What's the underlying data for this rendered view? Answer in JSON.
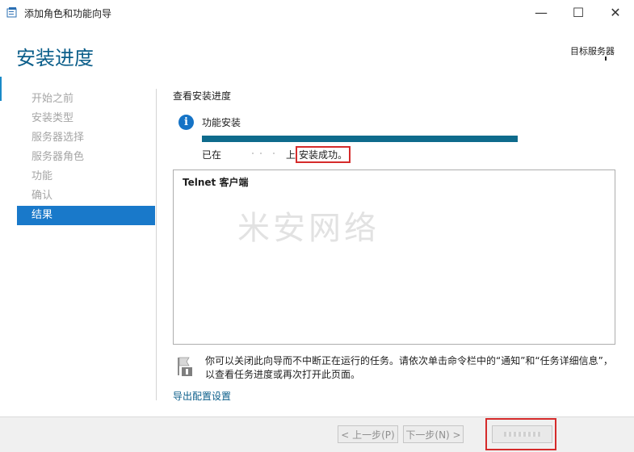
{
  "window": {
    "title": "添加角色和功能向导",
    "controls": {
      "minimize": "—",
      "maximize": "☐",
      "close": "✕"
    }
  },
  "header": {
    "title": "安装进度",
    "destination_server": "目标服务器"
  },
  "nav": {
    "items": [
      {
        "label": "开始之前",
        "active": false
      },
      {
        "label": "安装类型",
        "active": false
      },
      {
        "label": "服务器选择",
        "active": false
      },
      {
        "label": "服务器角色",
        "active": false
      },
      {
        "label": "功能",
        "active": false
      },
      {
        "label": "确认",
        "active": false
      },
      {
        "label": "结果",
        "active": true
      }
    ]
  },
  "main": {
    "section_title": "查看安装进度",
    "feature_install_label": "功能安装",
    "progress_percent": 100,
    "status_prefix": "已在",
    "status_on": "上",
    "status_success": "安装成功。",
    "results": [
      "Telnet 客户端"
    ],
    "watermark": "米安网络",
    "note": "你可以关闭此向导而不中断正在运行的任务。请依次单击命令栏中的“通知”和“任务详细信息”，以查看任务进度或再次打开此页面。",
    "export_link": "导出配置设置"
  },
  "footer": {
    "prev_label": "< 上一步(P)",
    "next_label": "下一步(N) >"
  },
  "colors": {
    "accent": "#1979ca",
    "title": "#0b5e8a",
    "progress": "#0e6b8c",
    "highlight": "#d52b2b"
  },
  "icons": {
    "app": "wizard-icon",
    "info": "info-icon",
    "note": "flag-icon"
  }
}
